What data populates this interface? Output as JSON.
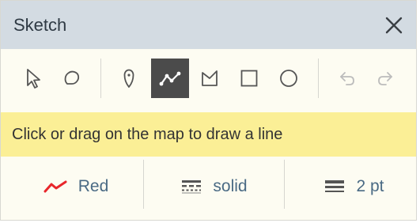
{
  "header": {
    "title": "Sketch",
    "close_icon": "close-icon"
  },
  "toolbar": {
    "tools": [
      {
        "name": "select",
        "icon": "select-cursor-icon"
      },
      {
        "name": "lasso",
        "icon": "lasso-icon"
      },
      {
        "name": "point",
        "icon": "pin-icon"
      },
      {
        "name": "line",
        "icon": "polyline-icon",
        "active": true
      },
      {
        "name": "polygon",
        "icon": "polygon-icon"
      },
      {
        "name": "rectangle",
        "icon": "rectangle-icon"
      },
      {
        "name": "circle",
        "icon": "circle-icon"
      },
      {
        "name": "undo",
        "icon": "undo-icon",
        "disabled": true
      },
      {
        "name": "redo",
        "icon": "redo-icon",
        "disabled": true
      }
    ]
  },
  "hint": {
    "text": "Click or drag on the map to draw a line"
  },
  "options": {
    "color": {
      "label": "Red",
      "icon": "color-line-icon",
      "swatch": "#e8262b"
    },
    "style": {
      "label": "solid",
      "icon": "line-style-icon"
    },
    "width": {
      "label": "2 pt",
      "icon": "line-width-icon"
    }
  },
  "colors": {
    "header_bg": "#d3dbe2",
    "panel_bg": "#fdfcf2",
    "hint_bg": "#fbef96",
    "active_tool_bg": "#4b4b4b",
    "option_text": "#4a6a84"
  }
}
